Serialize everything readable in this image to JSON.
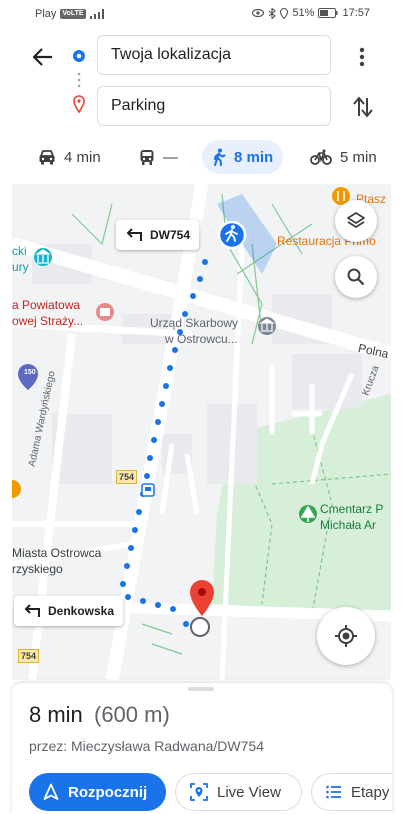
{
  "status_bar": {
    "carrier": "Play",
    "network_badge": "VoLTE",
    "battery": "51%",
    "time": "17:57"
  },
  "header": {
    "origin": "Twoja lokalizacja",
    "destination": "Parking"
  },
  "modes": [
    {
      "icon": "car-icon",
      "value": "4 min",
      "active": false
    },
    {
      "icon": "transit-icon",
      "value": "—",
      "active": false
    },
    {
      "icon": "walk-icon",
      "value": "8 min",
      "active": true
    },
    {
      "icon": "bike-icon",
      "value": "5 min",
      "active": false
    }
  ],
  "map": {
    "labels": {
      "ptasz": "Ptasz",
      "restaurant": "Restauracja Primo",
      "cki": "cki",
      "ury": "ury",
      "fire1": "a Powiatowa",
      "fire2": "owej Straży...",
      "tax1": "Urząd Skarbowy",
      "tax2": "w Ostrowcu...",
      "polna": "Polna",
      "krucza": "Krucza",
      "adama": "Adama Wardyńskiego",
      "cem1": "Cmentarz P",
      "cem2": "Michała Ar",
      "miasta1": "Miasta Ostrowca",
      "miasta2": "rzyskiego"
    },
    "shields": {
      "s754_mid": "754",
      "s754_bottom": "754",
      "badge_150": "150"
    },
    "callouts": {
      "top": "DW754",
      "bottom": "Denkowska"
    },
    "colors": {
      "route": "#1a73e8",
      "pin": "#ea4335",
      "park": "#d7eed8"
    }
  },
  "sheet": {
    "duration": "8 min",
    "distance": "(600 m)",
    "via": "przez: Mieczysława Radwana/DW754",
    "buttons": {
      "start": "Rozpocznij",
      "live_view": "Live View",
      "steps": "Etapy"
    }
  }
}
